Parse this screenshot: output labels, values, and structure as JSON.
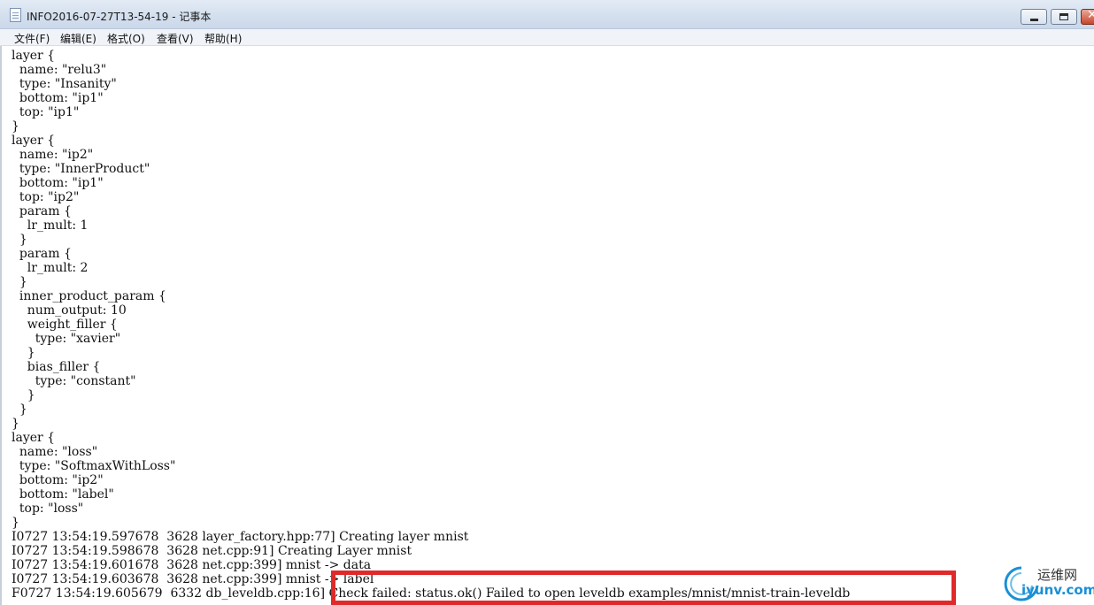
{
  "window": {
    "title": "INFO2016-07-27T13-54-19 - 记事本"
  },
  "menu": {
    "items": [
      {
        "label": "文件(F)"
      },
      {
        "label": "编辑(E)"
      },
      {
        "label": "格式(O)"
      },
      {
        "label": "查看(V)"
      },
      {
        "label": "帮助(H)"
      }
    ]
  },
  "editor": {
    "lines": [
      "layer {",
      "  name: \"relu3\"",
      "  type: \"Insanity\"",
      "  bottom: \"ip1\"",
      "  top: \"ip1\"",
      "}",
      "layer {",
      "  name: \"ip2\"",
      "  type: \"InnerProduct\"",
      "  bottom: \"ip1\"",
      "  top: \"ip2\"",
      "  param {",
      "    lr_mult: 1",
      "  }",
      "  param {",
      "    lr_mult: 2",
      "  }",
      "  inner_product_param {",
      "    num_output: 10",
      "    weight_filler {",
      "      type: \"xavier\"",
      "    }",
      "    bias_filler {",
      "      type: \"constant\"",
      "    }",
      "  }",
      "}",
      "layer {",
      "  name: \"loss\"",
      "  type: \"SoftmaxWithLoss\"",
      "  bottom: \"ip2\"",
      "  bottom: \"label\"",
      "  top: \"loss\"",
      "}",
      "I0727 13:54:19.597678  3628 layer_factory.hpp:77] Creating layer mnist",
      "I0727 13:54:19.598678  3628 net.cpp:91] Creating Layer mnist",
      "I0727 13:54:19.601678  3628 net.cpp:399] mnist -> data",
      "I0727 13:54:19.603678  3628 net.cpp:399] mnist -> label",
      "F0727 13:54:19.605679  6332 db_leveldb.cpp:16] Check failed: status.ok() Failed to open leveldb examples/mnist/mnist-train-leveldb"
    ]
  },
  "watermark": {
    "cn": "运维网",
    "en": "iyunv.com"
  },
  "colors": {
    "highlight": "#e02a2a",
    "watermark_blue": "#1b8fd6"
  }
}
